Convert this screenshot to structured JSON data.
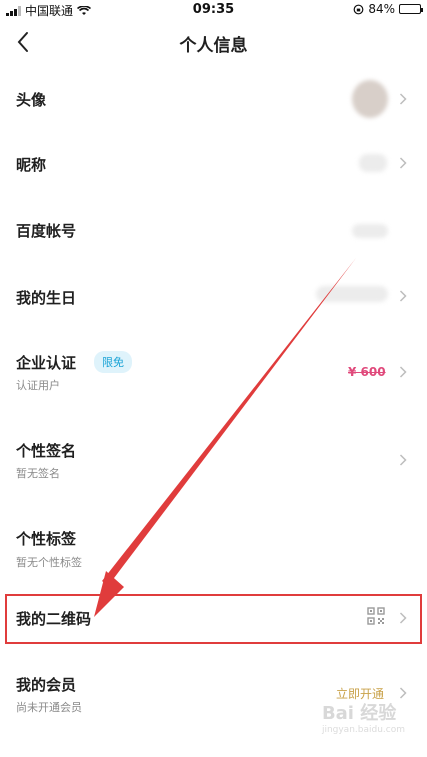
{
  "status": {
    "carrier": "中国联通",
    "time": "09:35",
    "battery": "84%",
    "battery_level": 0.84
  },
  "nav": {
    "title": "个人信息"
  },
  "rows": [
    {
      "label": "头像"
    },
    {
      "label": "昵称"
    },
    {
      "label": "百度帐号"
    },
    {
      "label": "我的生日"
    },
    {
      "label": "企业认证",
      "badge": "限免",
      "sub": "认证用户",
      "price": "¥ 600"
    },
    {
      "label": "个性签名",
      "sub": "暂无签名"
    },
    {
      "label": "个性标签",
      "sub": "暂无个性标签"
    },
    {
      "label": "我的二维码"
    },
    {
      "label": "我的会员",
      "sub": "尚未开通会员",
      "action": "立即开通"
    }
  ],
  "watermark": {
    "text": "Bai 经验",
    "url": "jingyan.baidu.com"
  },
  "colors": {
    "annotation": "#e03c3c",
    "badge_text": "#1aa3d6",
    "price": "#e0497b",
    "open": "#c9a24a"
  }
}
